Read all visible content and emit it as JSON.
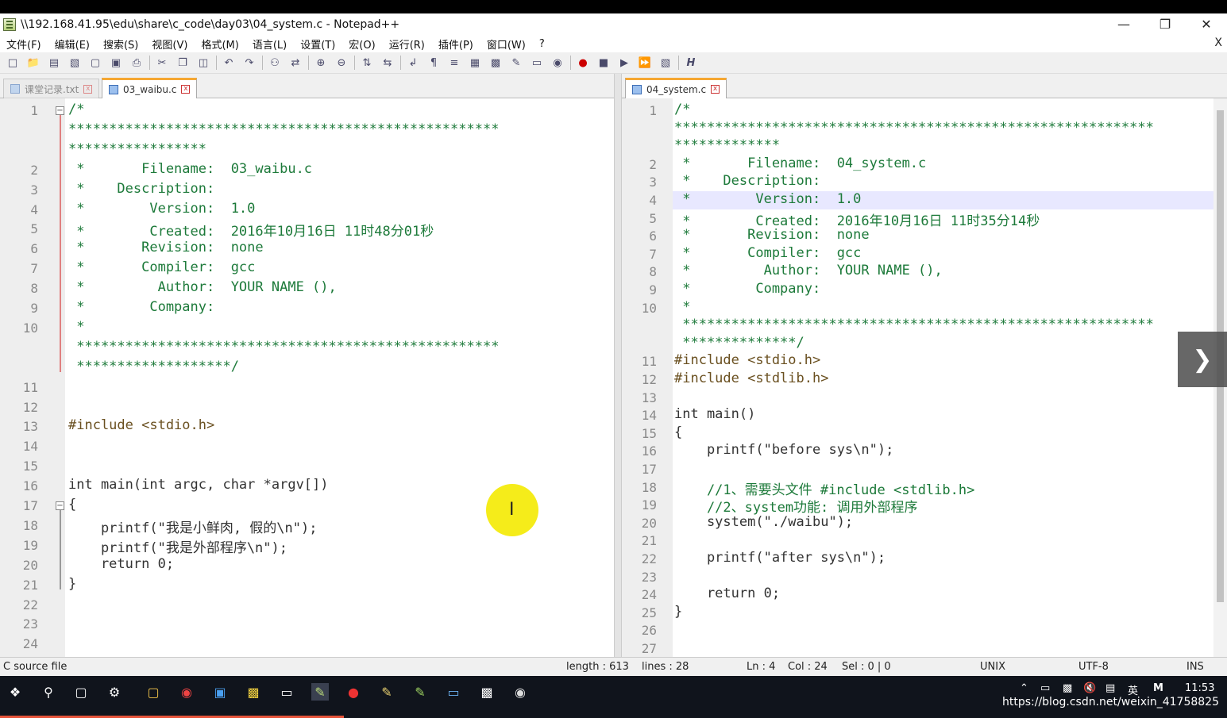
{
  "window": {
    "title": "\\\\192.168.41.95\\edu\\share\\c_code\\day03\\04_system.c - Notepad++",
    "min": "—",
    "restore": "❐",
    "close": "✕"
  },
  "menu": {
    "items": [
      "文件(F)",
      "编辑(E)",
      "搜索(S)",
      "视图(V)",
      "格式(M)",
      "语言(L)",
      "设置(T)",
      "宏(O)",
      "运行(R)",
      "插件(P)",
      "窗口(W)",
      "?"
    ],
    "close": "X"
  },
  "left": {
    "tabs": [
      {
        "label": "课堂记录.txt"
      },
      {
        "label": "03_waibu.c"
      }
    ]
  },
  "right": {
    "tabs": [
      {
        "label": "04_system.c"
      }
    ]
  },
  "left_lines": [
    {
      "n": "1",
      "t": "/*"
    },
    {
      "n": "",
      "t": "*****************************************************"
    },
    {
      "n": "",
      "t": "*****************"
    },
    {
      "n": "2",
      "t": " *       Filename:  03_waibu.c"
    },
    {
      "n": "3",
      "t": " *    Description:"
    },
    {
      "n": "4",
      "t": " *        Version:  1.0"
    },
    {
      "n": "5",
      "t": " *        Created:  2016年10月16日 11时48分01秒"
    },
    {
      "n": "6",
      "t": " *       Revision:  none"
    },
    {
      "n": "7",
      "t": " *       Compiler:  gcc"
    },
    {
      "n": "8",
      "t": " *         Author:  YOUR NAME (),"
    },
    {
      "n": "9",
      "t": " *        Company:"
    },
    {
      "n": "10",
      "t": " *"
    },
    {
      "n": "",
      "t": " ****************************************************"
    },
    {
      "n": "",
      "t": " *******************/"
    },
    {
      "n": "11",
      "t": ""
    },
    {
      "n": "12",
      "t": ""
    },
    {
      "n": "13",
      "t": "#include <stdio.h>"
    },
    {
      "n": "14",
      "t": ""
    },
    {
      "n": "15",
      "t": ""
    },
    {
      "n": "16",
      "t": "int main(int argc, char *argv[])"
    },
    {
      "n": "17",
      "t": "{"
    },
    {
      "n": "18",
      "t": "    printf(\"我是小鲜肉, 假的\\n\");"
    },
    {
      "n": "19",
      "t": "    printf(\"我是外部程序\\n\");"
    },
    {
      "n": "20",
      "t": "    return 0;"
    },
    {
      "n": "21",
      "t": "}"
    },
    {
      "n": "22",
      "t": ""
    },
    {
      "n": "23",
      "t": ""
    },
    {
      "n": "24",
      "t": ""
    }
  ],
  "right_lines": [
    {
      "n": "1",
      "t": "/*"
    },
    {
      "n": "",
      "t": "***********************************************************"
    },
    {
      "n": "",
      "t": "*************"
    },
    {
      "n": "2",
      "t": " *       Filename:  04_system.c"
    },
    {
      "n": "3",
      "t": " *    Description:"
    },
    {
      "n": "4",
      "t": " *        Version:  1.0"
    },
    {
      "n": "5",
      "t": " *        Created:  2016年10月16日 11时35分14秒"
    },
    {
      "n": "6",
      "t": " *       Revision:  none"
    },
    {
      "n": "7",
      "t": " *       Compiler:  gcc"
    },
    {
      "n": "8",
      "t": " *         Author:  YOUR NAME (),"
    },
    {
      "n": "9",
      "t": " *        Company:"
    },
    {
      "n": "10",
      "t": " *"
    },
    {
      "n": "",
      "t": " **********************************************************"
    },
    {
      "n": "",
      "t": " **************/"
    },
    {
      "n": "11",
      "t": "#include <stdio.h>"
    },
    {
      "n": "12",
      "t": "#include <stdlib.h>"
    },
    {
      "n": "13",
      "t": ""
    },
    {
      "n": "14",
      "t": "int main()"
    },
    {
      "n": "15",
      "t": "{"
    },
    {
      "n": "16",
      "t": "    printf(\"before sys\\n\");"
    },
    {
      "n": "17",
      "t": ""
    },
    {
      "n": "18",
      "t": "    //1、需要头文件 #include <stdlib.h>"
    },
    {
      "n": "19",
      "t": "    //2、system功能: 调用外部程序"
    },
    {
      "n": "20",
      "t": "    system(\"./waibu\");"
    },
    {
      "n": "21",
      "t": ""
    },
    {
      "n": "22",
      "t": "    printf(\"after sys\\n\");"
    },
    {
      "n": "23",
      "t": ""
    },
    {
      "n": "24",
      "t": "    return 0;"
    },
    {
      "n": "25",
      "t": "}"
    },
    {
      "n": "26",
      "t": ""
    },
    {
      "n": "27",
      "t": ""
    }
  ],
  "status": {
    "type": "C source file",
    "length": "length : 613",
    "lines": "lines : 28",
    "ln": "Ln : 4",
    "col": "Col : 24",
    "sel": "Sel : 0 | 0",
    "eol": "UNIX",
    "enc": "UTF-8",
    "mode": "INS"
  },
  "taskbar": {
    "time": "11:53",
    "ime": "英",
    "watermark": "https://blog.csdn.net/weixin_41758825"
  },
  "colors": {
    "fold_marker": "#e08080",
    "comment": "#1d7a3a",
    "keyword": "#7040a0",
    "tab_accent": "#f6a732",
    "cursor_highlight": "#f5ec1a"
  }
}
